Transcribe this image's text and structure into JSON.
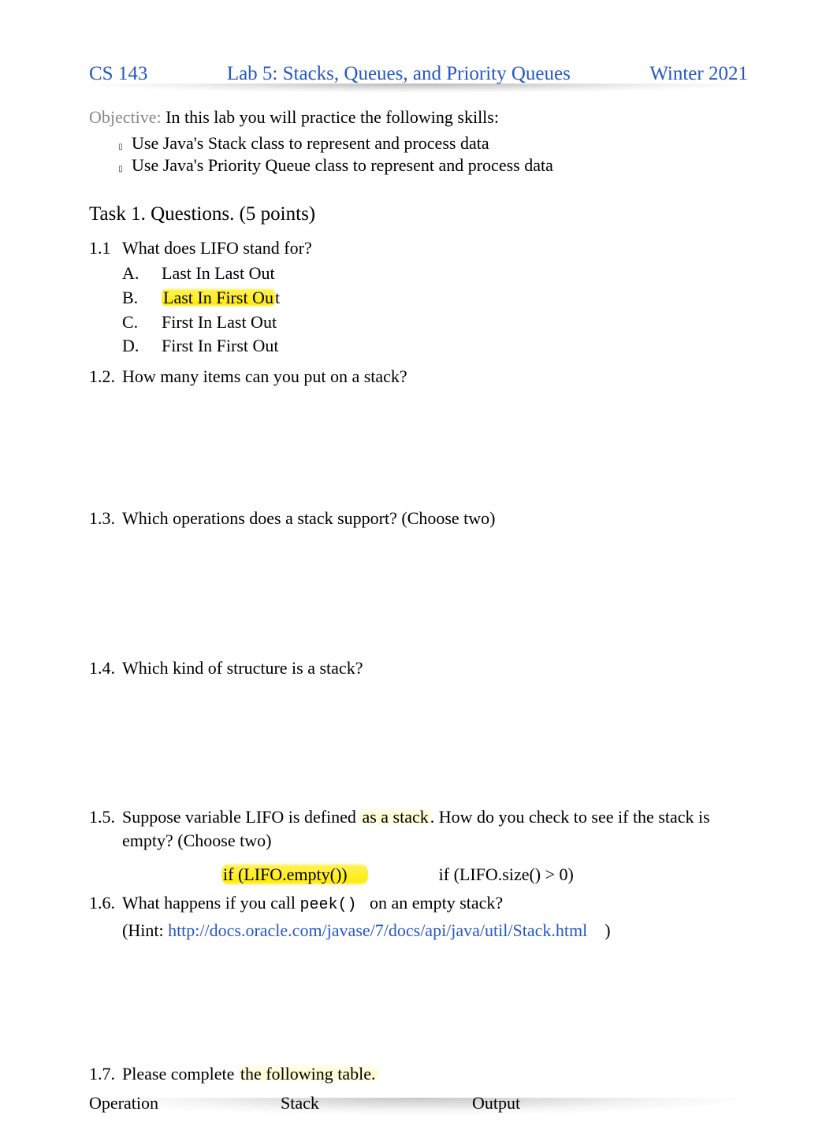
{
  "header": {
    "left": "CS 143",
    "center": "Lab 5: Stacks, Queues, and Priority Queues",
    "right": "Winter 2021"
  },
  "objective": {
    "label": "Objective:",
    "text": "In this lab you will practice the following skills:",
    "items": [
      "Use Java's Stack class to represent and process data",
      "Use Java's Priority Queue class to represent and process data"
    ]
  },
  "task1": {
    "heading_prefix": "Task 1. ",
    "heading_rest": "Questions. (5 points)"
  },
  "q11": {
    "num": "1.1",
    "text": "What does LIFO stand for?",
    "a_letter": "A.",
    "a_text": "Last In Last Out",
    "b_letter": "B.",
    "b_text_hl": "Last In First Ou",
    "b_text_tail": "t",
    "c_letter": "C.",
    "c_text": "First In Last Out",
    "d_letter": "D.",
    "d_text": "First In First Out"
  },
  "q12": {
    "num": "1.2.",
    "text": "How many items can you put on a stack?"
  },
  "q13": {
    "num": "1.3.",
    "text": "Which operations does a stack support? (Choose two)"
  },
  "q14": {
    "num": "1.4.",
    "text": "Which kind of structure is a stack?"
  },
  "q15": {
    "num": "1.5.",
    "text_pre": "Suppose variable LIFO is defined ",
    "text_hl": "as a stack",
    "text_post": ". How do you check to see if the stack is empty? (Choose two)",
    "opt1": "if (LIFO.empty())",
    "opt2": "if (LIFO.size() > 0)"
  },
  "q16": {
    "num": "1.6.",
    "text_pre": "What happens if you call ",
    "text_mono": "peek()",
    "text_post": " on an empty stack?",
    "hint_pre": "(Hint: ",
    "hint_link": "http://docs.oracle.com/javase/7/docs/api/java/util/Stack.html",
    "hint_post": ")"
  },
  "q17": {
    "num": "1.7.",
    "text_pre": "Please complete ",
    "text_hl": "the following table.",
    "table": {
      "h1": "Operation",
      "h2": "Stack",
      "h3": "Output"
    }
  }
}
